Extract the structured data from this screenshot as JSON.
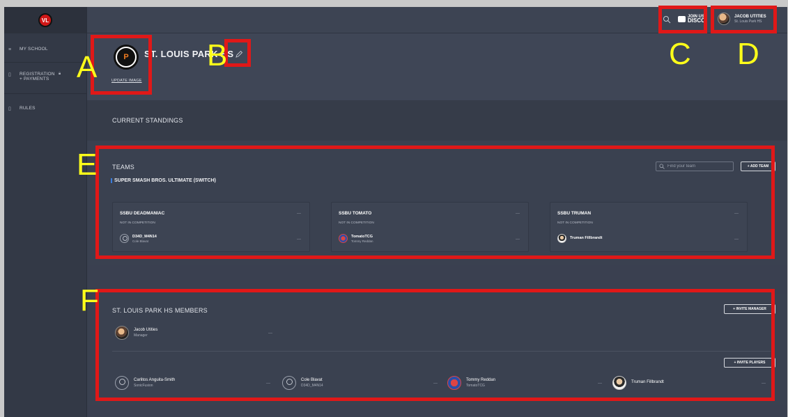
{
  "sidebar": {
    "logo_text": "VL",
    "items": [
      {
        "label": "MY SCHOOL"
      },
      {
        "label": "REGISTRATION + PAYMENTS"
      },
      {
        "label": "RULES"
      }
    ]
  },
  "topbar": {
    "discord_line1": "JOIN US",
    "discord_line2": "DISCO",
    "user_name": "JACOB UTITIES",
    "user_school": "St. Louis Park HS"
  },
  "header": {
    "school_name": "ST. LOUIS PARK HS",
    "logo_text": "P",
    "update_image": "UPDATE IMAGE"
  },
  "standings": {
    "title": "CURRENT STANDINGS"
  },
  "teams": {
    "title": "TEAMS",
    "search_placeholder": "Find your team",
    "add_team": "+ ADD TEAM",
    "game": "SUPER SMASH BROS. ULTIMATE (SWITCH)",
    "cards": [
      {
        "name": "SSBU DEADMANIAC",
        "status": "NOT IN COMPETITION",
        "player": "D34D_M4N14",
        "player_sub": "Cole Blavat",
        "menu": "—",
        "pmenu": "—"
      },
      {
        "name": "SSBU TOMATO",
        "status": "NOT IN COMPETITION",
        "player": "TomatoTCG",
        "player_sub": "Tommy Reddan",
        "menu": "—",
        "pmenu": "—"
      },
      {
        "name": "SSBU TRUMAN",
        "status": "NOT IN COMPETITION",
        "player": "Truman Fillbrandt",
        "player_sub": "",
        "menu": "—",
        "pmenu": "—"
      }
    ]
  },
  "members": {
    "title": "ST. LOUIS PARK HS MEMBERS",
    "invite_manager": "+ INVITE MANAGER",
    "invite_players": "+ INVITE PLAYERS",
    "manager": {
      "name": "Jacob Utities",
      "role": "Manager",
      "menu": "—"
    },
    "players": [
      {
        "name": "Carlitos Anguita-Smith",
        "sub": "SonicFusion",
        "menu": "—"
      },
      {
        "name": "Cole Blavat",
        "sub": "D34D_M4N14",
        "menu": "—"
      },
      {
        "name": "Tommy Reddan",
        "sub": "TomatoTCG",
        "menu": "—"
      },
      {
        "name": "Truman Fillbrandt",
        "sub": "",
        "menu": "—"
      }
    ]
  },
  "annotations": [
    "A",
    "B",
    "C",
    "D",
    "E",
    "F"
  ],
  "colors": {
    "annotation_box": "#e01818",
    "annotation_label": "#ffff1a",
    "accent": "#3b7ddd"
  }
}
